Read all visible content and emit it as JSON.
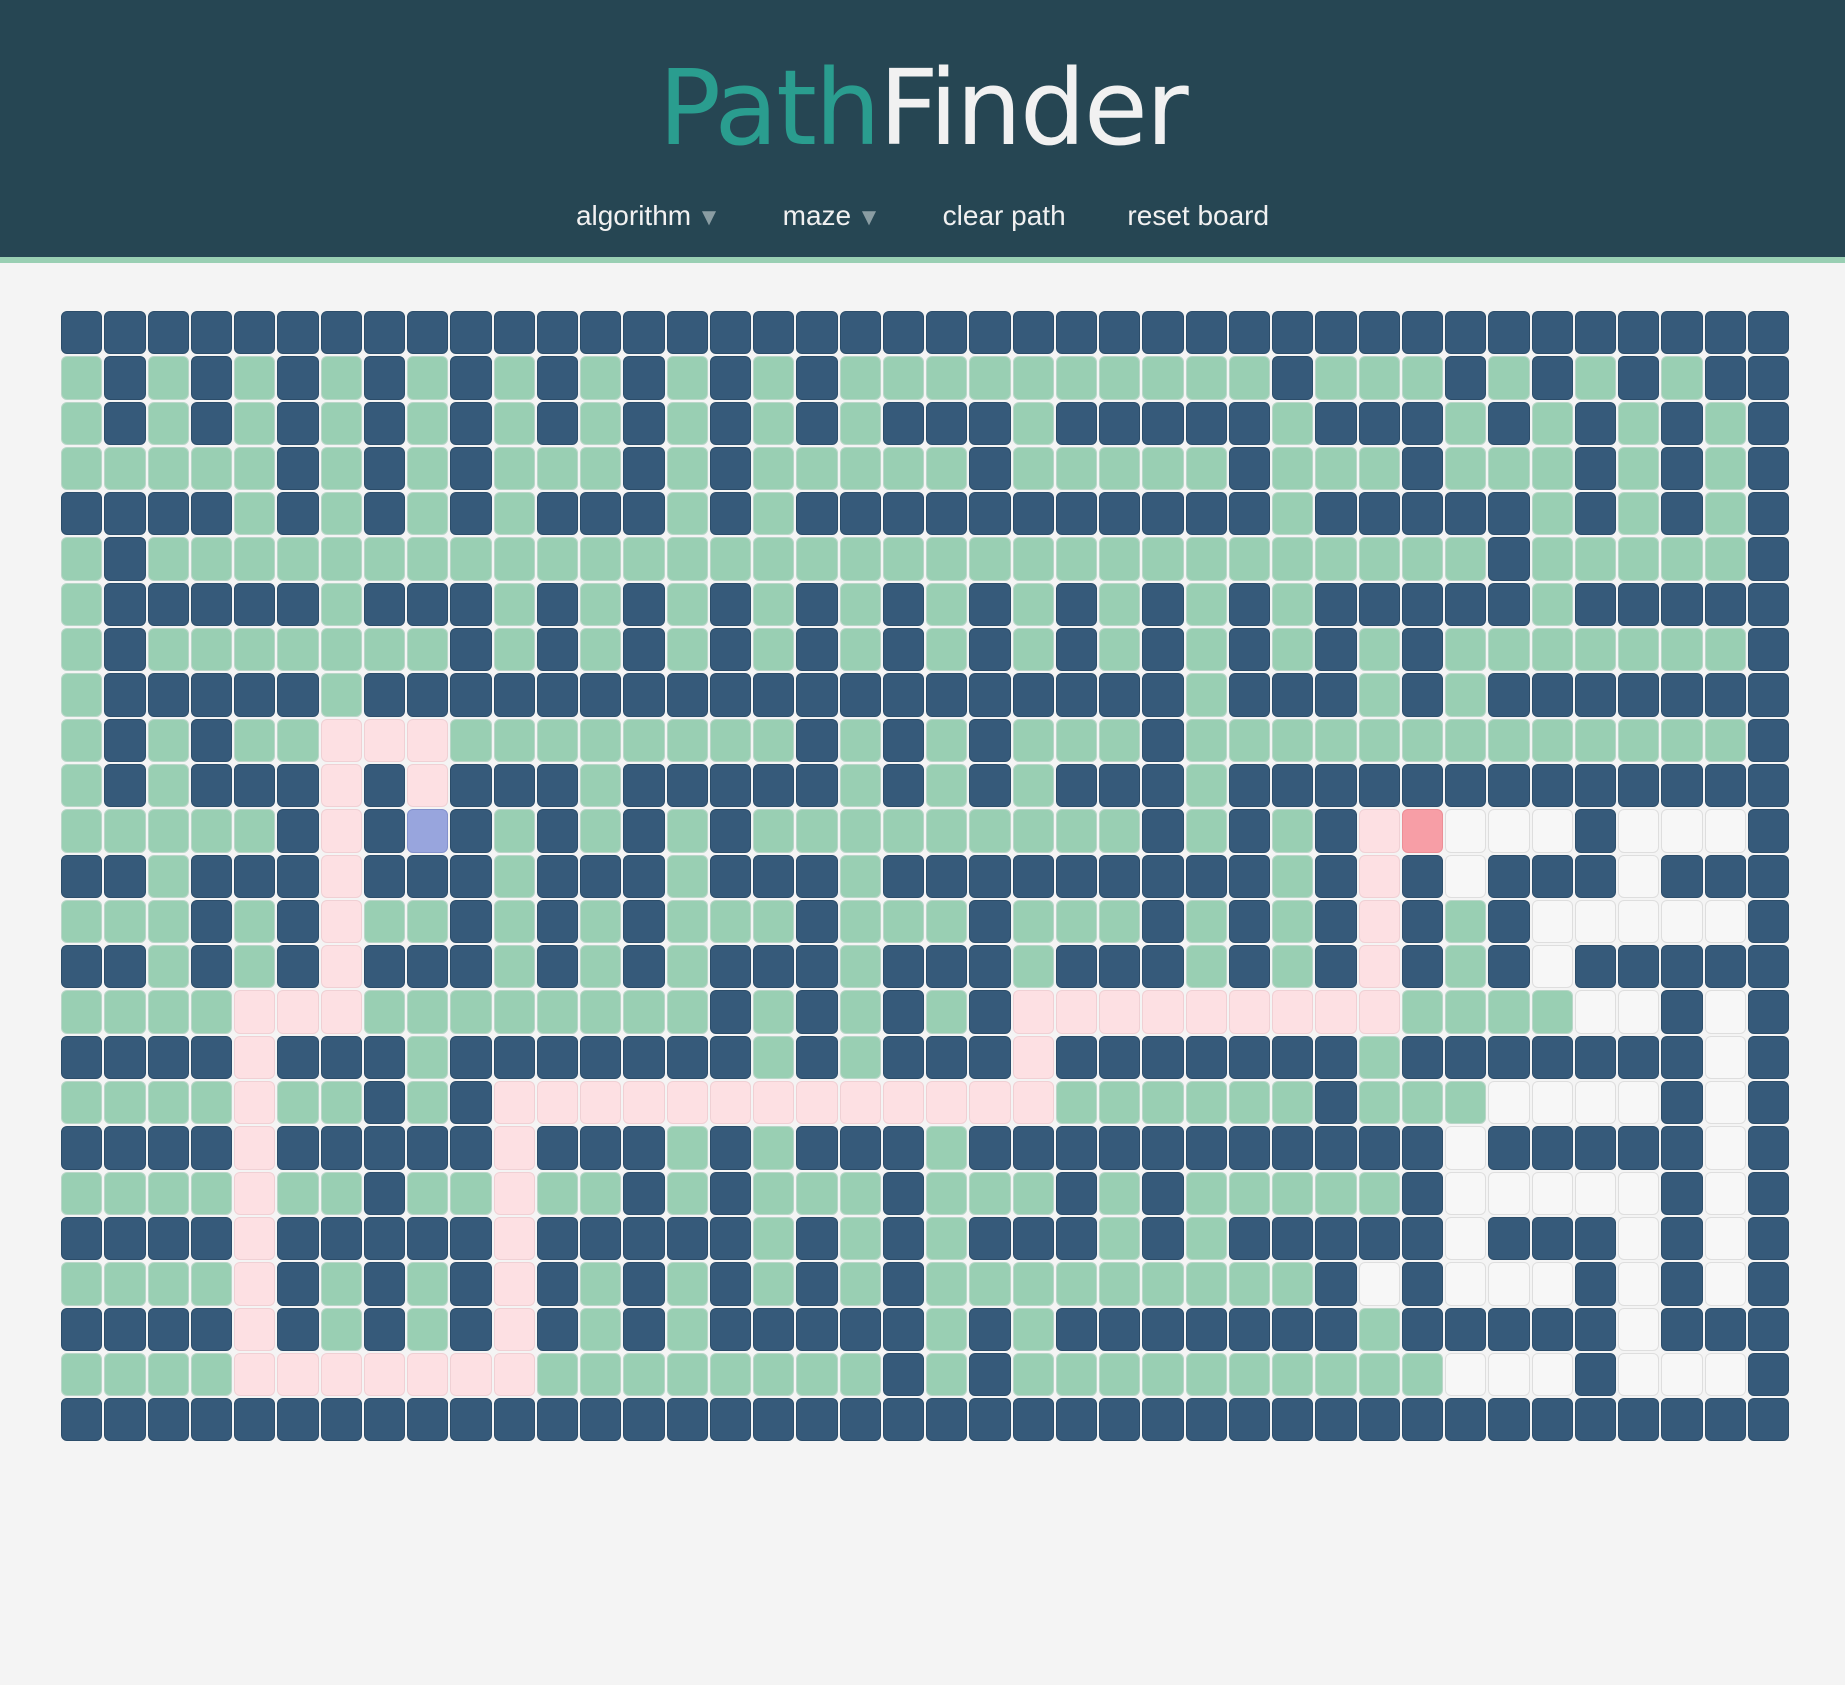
{
  "header": {
    "logo_part1": "Path",
    "logo_part2": "Finder",
    "nav": {
      "algorithm": "algorithm",
      "maze": "maze",
      "clear_path": "clear path",
      "reset_board": "reset board"
    }
  },
  "colors": {
    "header_bg": "#264653",
    "accent": "#2a9d8f",
    "wall": "#365a7a",
    "visited": "#99cfb3",
    "path": "#fde0e3",
    "empty": "#f7f7f7",
    "start": "#98a5dd",
    "target": "#f79ea6"
  },
  "grid": {
    "legend": {
      "W": "wall",
      "V": "visited",
      "E": "empty",
      "P": "path",
      "S": "start",
      "T": "target"
    },
    "rows": [
      "WWWWWWWWWWWWWWWWWWWWWWWWWWWWWWWWWWWWWWWW",
      "VWVWVWVWVWVWVWVWVWVVVVVVVVVVWVVVWVWVWVWW",
      "VWVWVWVWVWVWVWVWVWVWWWVWWWWWVWWWVWVWVWVW",
      "VVVVVWVWVWVVVWVWVVVVVWVVVVVWVVVWVVVWVWVW",
      "WWWWVWVWVWVWWWVWVWWWWWWWWWWWVWWWWWVWVWVW",
      "VWVVVVVVVVVVVVVVVVVVVVVVVVVVVVVVVWVVVVVW",
      "VWWWWWVWWWVWVWVWVWVWVWVWVWVWVWWWWWVWWWWW",
      "VWVVVVVVVWVWVWVWVWVWVWVWVWVWVWVWVVVVVVVW",
      "VWWWWWVWWWWWWWWWWWWWWWWWWWVWWWVWVWWWWWWW",
      "VWVWVVPPPVVVVVVVVWVWVWVVVWVVVVVVVVVVVVVW",
      "VWVWWWPWPWWWVWWWWWVWVWVWWWVWWWWWWWWWWWWW",
      "VVVVVWPWSWVWVWVWVVVVVVVVVWVWVWPTEEEWEEEW",
      "WWVWWWPWWWVWWWVWWWVWWWWWWWWWVWPWEWWWEWWW",
      "VVVWVWPVVWVWVWVVVWVVVWVVVWVWVWPWVWEEEEEW",
      "WWVWVWPWWWVWVWVWWWVWWWVWWWVWVWPWVWEWWWWW",
      "VVVVPPPVVVVVVVVWVWVWVWPPPPPPPPPVVVVEEWEW",
      "WWWWPWWWVWWWWWWWVWVWWWPWWWWWWWVWWWWWWWEW",
      "VVVVPVVWVWPPPPPPPPPPPPPVVVVVVWVVVEEEEWEW",
      "WWWWPWWWWWPWWWVWVWWWVWWWWWWWWWWWEWWWWWEW",
      "VVVVPVVWVVPVVWVWVVVWVVVWVWVVVVVWEEEEEWEW",
      "WWWWPWWWWWPWWWWWVWVWVWWWVWVWWWWWEWWWEWEW",
      "VVVVPWVWVWPWVWVWVWVWVVVVVVVVVWEWEEEWEWEW",
      "WWWWPWVWVWPWVWVWWWWWVWVWWWWWWWVWWWWWEWWW",
      "VVVVPPPPPPPVVVVVVVVWVWVVVVVVVVVVEEEWEEEW",
      "WWWWWWWWWWWWWWWWWWWWWWWWWWWWWWWWWWWWWWWW"
    ]
  }
}
